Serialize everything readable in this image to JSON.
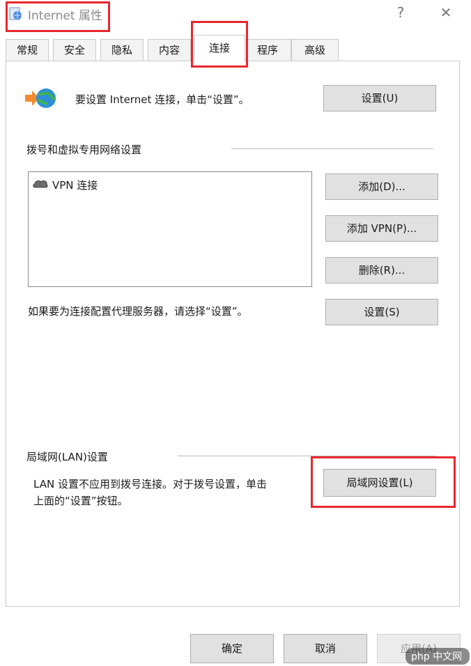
{
  "window": {
    "title": "Internet 属性",
    "help": "?",
    "close": "✕"
  },
  "tabs": [
    {
      "label": "常规"
    },
    {
      "label": "安全"
    },
    {
      "label": "隐私"
    },
    {
      "label": "内容"
    },
    {
      "label": "连接"
    },
    {
      "label": "程序"
    },
    {
      "label": "高级"
    }
  ],
  "setup": {
    "text": "要设置 Internet 连接，单击“设置”。",
    "button": "设置(U)"
  },
  "dialup": {
    "heading": "拨号和虚拟专用网络设置",
    "items": [
      {
        "label": "VPN 连接"
      }
    ],
    "add_button": "添加(D)...",
    "add_vpn_button": "添加 VPN(P)...",
    "delete_button": "删除(R)...",
    "proxy_text": "如果要为连接配置代理服务器，请选择“设置”。",
    "settings_button": "设置(S)"
  },
  "lan": {
    "heading": "局域网(LAN)设置",
    "text_line1": "LAN 设置不应用到拨号连接。对于拨号设置，单击",
    "text_line2": "上面的“设置”按钮。",
    "button": "局域网设置(L)"
  },
  "footer": {
    "ok": "确定",
    "cancel": "取消",
    "apply": "应用(A)"
  },
  "watermark": "php 中文网",
  "colors": {
    "highlight": "#e8262d"
  }
}
